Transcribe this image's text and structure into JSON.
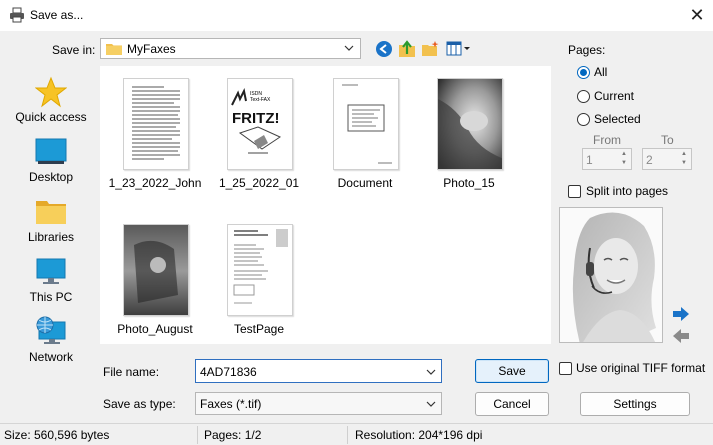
{
  "window": {
    "title": "Save as...",
    "close_glyph": "✕"
  },
  "location": {
    "label": "Save in:",
    "value": "MyFaxes"
  },
  "places": [
    {
      "label": "Quick access",
      "icon": "star-icon"
    },
    {
      "label": "Desktop",
      "icon": "desktop-icon"
    },
    {
      "label": "Libraries",
      "icon": "libraries-icon"
    },
    {
      "label": "This PC",
      "icon": "this-pc-icon"
    },
    {
      "label": "Network",
      "icon": "network-icon"
    }
  ],
  "files": [
    {
      "name": "1_23_2022_John",
      "kind": "text-doc"
    },
    {
      "name": "1_25_2022_01",
      "kind": "fritz-fax",
      "thumb_text": {
        "brand": "FRITZ!",
        "line1": "ISDN",
        "line2": "Text-FAX"
      }
    },
    {
      "name": "Document",
      "kind": "small-doc"
    },
    {
      "name": "Photo_15",
      "kind": "photo"
    },
    {
      "name": "Photo_August",
      "kind": "photo-dark"
    },
    {
      "name": "TestPage",
      "kind": "test-page"
    }
  ],
  "filename": {
    "label": "File name:",
    "value": "4AD71836"
  },
  "filetype": {
    "label": "Save as type:",
    "value": "Faxes (*.tif)"
  },
  "buttons": {
    "save": "Save",
    "cancel": "Cancel",
    "settings": "Settings"
  },
  "pages": {
    "label": "Pages:",
    "options": [
      "All",
      "Current",
      "Selected"
    ],
    "selected": "All",
    "from_label": "From",
    "to_label": "To",
    "from_value": "1",
    "to_value": "2",
    "split_label": "Split into pages",
    "split_checked": false
  },
  "tiff": {
    "label": "Use original TIFF format",
    "checked": false
  },
  "status": {
    "size": "Size: 560,596 bytes",
    "pages": "Pages: 1/2",
    "resolution": "Resolution: 204*196 dpi"
  },
  "colors": {
    "accent": "#0067c0",
    "folder": "#f2c14e",
    "nav_blue": "#1a73c8"
  }
}
